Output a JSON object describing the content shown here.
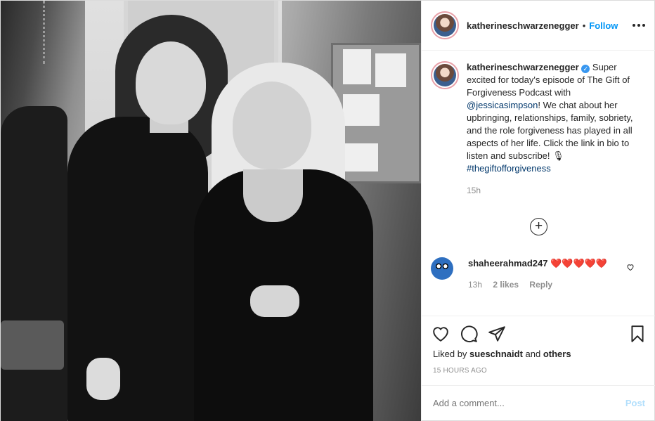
{
  "header": {
    "username": "katherineschwarzenegger",
    "separator": "•",
    "follow_label": "Follow"
  },
  "caption": {
    "username": "katherineschwarzenegger",
    "verified_symbol": "✓",
    "text_before_mention": " Super excited for today's episode of The Gift of Forgiveness Podcast with ",
    "mention": "@jessicasimpson",
    "text_after_mention": "! We chat about her upbringing, relationships, family, sobriety, and the role forgiveness has played in all aspects of her life. Click the link in bio to listen and subscribe! ",
    "mic_emoji": "🎙",
    "hashtag": "#thegiftofforgiveness",
    "time": "15h"
  },
  "load_more_symbol": "+",
  "comment": {
    "username": "shaheerahmad247",
    "hearts": "❤️❤️❤️❤️❤️",
    "time": "13h",
    "likes": "2 likes",
    "reply": "Reply"
  },
  "actions": {
    "liked_prefix": "Liked by ",
    "liked_user": "sueschnaidt",
    "liked_and": " and ",
    "liked_others": "others",
    "time_ago": "15 HOURS AGO"
  },
  "add_comment": {
    "placeholder": "Add a comment...",
    "post_label": "Post"
  },
  "colors": {
    "accent": "#0095f6",
    "link": "#00376b",
    "muted": "#8e8e8e",
    "verified": "#3897f0"
  }
}
